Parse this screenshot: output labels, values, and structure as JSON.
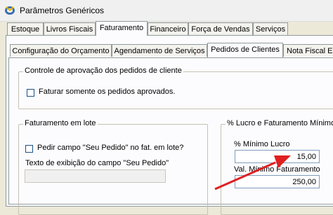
{
  "window": {
    "title": "Parâmetros Genéricos"
  },
  "main_tabs": [
    {
      "label": "Estoque"
    },
    {
      "label": "Livros Fiscais"
    },
    {
      "label": "Faturamento"
    },
    {
      "label": "Financeiro"
    },
    {
      "label": "Força de Vendas"
    },
    {
      "label": "Serviços"
    }
  ],
  "sub_tabs": [
    {
      "label": "Configuração do Orçamento"
    },
    {
      "label": "Agendamento de Serviços"
    },
    {
      "label": "Pedidos de Clientes"
    },
    {
      "label": "Nota Fiscal El"
    }
  ],
  "approval_group": {
    "title": "Controle de aprovação dos pedidos de cliente",
    "checkbox_label": "Faturar somente os pedidos aprovados."
  },
  "batch_group": {
    "title": "Faturamento em lote",
    "checkbox_label": "Pedir campo \"Seu Pedido\" no fat. em lote?",
    "text_label": "Texto de exibição do campo \"Seu Pedido\"",
    "text_value": ""
  },
  "profit_group": {
    "title": "% Lucro e Faturamento Mínimo",
    "min_profit_label": "% Mínimo Lucro",
    "min_profit_value": "15,00",
    "min_billing_label": "Val. Mínimo Faturamento",
    "min_billing_value": "250,00"
  },
  "colors": {
    "annotation_arrow": "#e02020",
    "tab_border": "#919b9c",
    "panel_bg": "#fcfcfe"
  }
}
